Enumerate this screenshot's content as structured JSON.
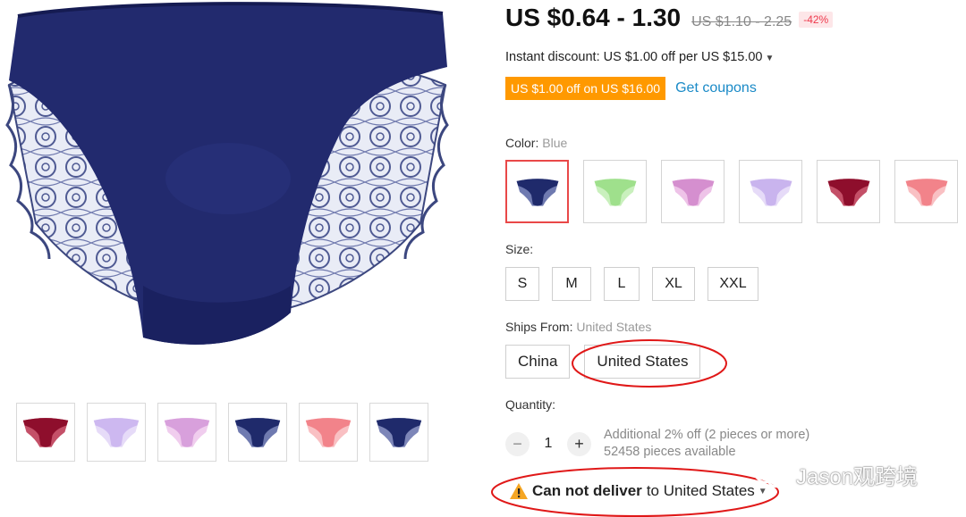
{
  "price": {
    "current": "US $0.64 - 1.30",
    "original": "US $1.10 - 2.25",
    "discount": "-42%"
  },
  "instant_discount": {
    "text": "Instant discount: US $1.00 off per US $15.00"
  },
  "coupon": {
    "tag": "US $1.00 off on US $16.00",
    "link": "Get coupons"
  },
  "color": {
    "label": "Color:",
    "selected": "Blue",
    "swatches": [
      {
        "name": "blue",
        "color": "#1f2a6b",
        "lace": "#6f7ab0"
      },
      {
        "name": "green",
        "color": "#9fe08c",
        "lace": "#c9f0bd"
      },
      {
        "name": "pink-purple",
        "color": "#d58fcf",
        "lace": "#eec3e8"
      },
      {
        "name": "lavender",
        "color": "#c9b4ee",
        "lace": "#e6dbf8"
      },
      {
        "name": "wine",
        "color": "#8e0e2c",
        "lace": "#c45068"
      },
      {
        "name": "salmon",
        "color": "#f2838a",
        "lace": "#f9c0c3"
      }
    ]
  },
  "size": {
    "label": "Size:",
    "options": [
      "S",
      "M",
      "L",
      "XL",
      "XXL"
    ]
  },
  "ships_from": {
    "label": "Ships From:",
    "selected": "United States",
    "options": [
      "China",
      "United States"
    ]
  },
  "quantity": {
    "label": "Quantity:",
    "value": "1",
    "minus": "−",
    "plus": "+",
    "promo": "Additional 2% off (2 pieces or more)",
    "available": "52458 pieces available"
  },
  "delivery": {
    "warning": "Can not deliver",
    "rest": "to United States"
  },
  "gallery": {
    "main_color": "#222a6e",
    "thumbnails": [
      {
        "color": "#8e0e2c",
        "lace": "#c45068"
      },
      {
        "color": "#cdb8f0",
        "lace": "#e6dbf8"
      },
      {
        "color": "#d8a0dc",
        "lace": "#f0cdee"
      },
      {
        "color": "#1f2a6b",
        "lace": "#6f7ab0"
      },
      {
        "color": "#f2838a",
        "lace": "#f9c0c3"
      },
      {
        "color": "#1f2a6b",
        "lace": "#7d86b8"
      }
    ]
  },
  "watermark": {
    "text": "Jason观跨境"
  },
  "annotation_color": "#e01818"
}
